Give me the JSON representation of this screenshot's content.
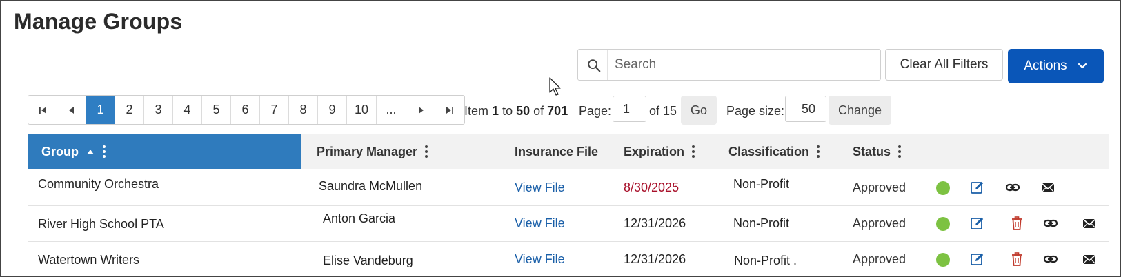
{
  "page": {
    "title": "Manage Groups"
  },
  "search": {
    "placeholder": "Search",
    "value": ""
  },
  "toolbar": {
    "clear_label": "Clear All Filters",
    "actions_label": "Actions"
  },
  "pager": {
    "pages": [
      "1",
      "2",
      "3",
      "4",
      "5",
      "6",
      "7",
      "8",
      "9",
      "10",
      "..."
    ],
    "current": "1",
    "item_prefix": "Item",
    "item_from": "1",
    "item_to_word": "to",
    "item_to": "50",
    "item_of_word": "of",
    "item_total": "701",
    "page_label": "Page:",
    "page_value": "1",
    "of_pages": "of 15",
    "go_label": "Go",
    "size_label": "Page size:",
    "size_value": "50",
    "change_label": "Change"
  },
  "columns": {
    "group": "Group",
    "primary_manager": "Primary Manager",
    "insurance_file": "Insurance File",
    "expiration": "Expiration",
    "classification": "Classification",
    "status": "Status"
  },
  "rows": [
    {
      "group": "Community Orchestra",
      "manager": "Saundra McMullen",
      "file": "View File",
      "expiration": "8/30/2025",
      "expiration_expiring": true,
      "classification": "Non-Profit",
      "status": "Approved",
      "deletable": false
    },
    {
      "group": "River High School PTA",
      "manager": "Anton Garcia",
      "file": "View File",
      "expiration": "12/31/2026",
      "expiration_expiring": false,
      "classification": "Non-Profit",
      "status": "Approved",
      "deletable": true
    },
    {
      "group": "Watertown Writers",
      "manager": "Elise Vandeburg",
      "file": "View File",
      "expiration": "12/31/2026",
      "expiration_expiring": false,
      "classification": "Non-Profit .",
      "status": "Approved",
      "deletable": true
    }
  ],
  "colors": {
    "accent": "#0a56b8",
    "header_sorted": "#2f7bbd",
    "status_ok": "#7dc242",
    "link": "#1a5fa8",
    "expiring_date": "#a8102a",
    "delete_icon": "#c0392b"
  },
  "icons": {
    "search": "search-icon",
    "actions_chevron": "chevron-down-icon",
    "first": "first-page-icon",
    "prev": "prev-page-icon",
    "next": "next-page-icon",
    "last": "last-page-icon",
    "status": "status-dot-icon",
    "edit": "edit-icon",
    "delete": "trash-icon",
    "link": "link-icon",
    "email": "envelope-icon"
  }
}
